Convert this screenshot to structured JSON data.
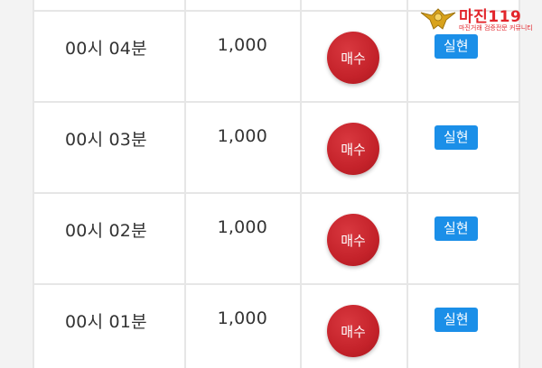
{
  "rows": [
    {
      "time": "",
      "amount": "",
      "buy_label": "",
      "status": ""
    },
    {
      "time": "00시 04분",
      "amount": "1,000",
      "buy_label": "매수",
      "status": "실현"
    },
    {
      "time": "00시 03분",
      "amount": "1,000",
      "buy_label": "매수",
      "status": "실현"
    },
    {
      "time": "00시 02분",
      "amount": "1,000",
      "buy_label": "매수",
      "status": "실현"
    },
    {
      "time": "00시 01분",
      "amount": "1,000",
      "buy_label": "매수",
      "status": "실현"
    }
  ],
  "watermark": {
    "name": "마진",
    "suffix": "119",
    "tagline": "마진거래 검증전문 커뮤니티"
  },
  "colors": {
    "buy_button": "#c4222a",
    "status_badge": "#1b8fe8",
    "grid_line": "#e6e6e6",
    "watermark": "#e2252b"
  }
}
